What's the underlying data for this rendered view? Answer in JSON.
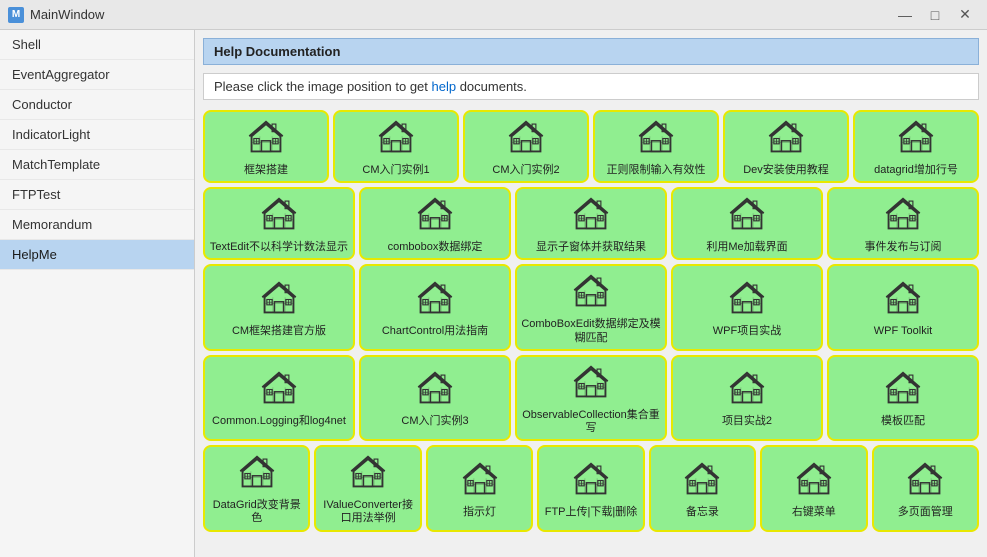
{
  "window": {
    "title": "MainWindow",
    "icon": "M",
    "minimize_label": "—",
    "maximize_label": "□",
    "close_label": "✕"
  },
  "sidebar": {
    "items": [
      {
        "id": "shell",
        "label": "Shell",
        "active": false
      },
      {
        "id": "event-aggregator",
        "label": "EventAggregator",
        "active": false
      },
      {
        "id": "conductor",
        "label": "Conductor",
        "active": false
      },
      {
        "id": "indicator-light",
        "label": "IndicatorLight",
        "active": false
      },
      {
        "id": "match-template",
        "label": "MatchTemplate",
        "active": false
      },
      {
        "id": "ftp-test",
        "label": "FTPTest",
        "active": false
      },
      {
        "id": "memorandum",
        "label": "Memorandum",
        "active": false
      },
      {
        "id": "help-me",
        "label": "HelpMe",
        "active": true
      }
    ]
  },
  "help": {
    "header": "Help Documentation",
    "description_plain": "Please click the image position to get ",
    "description_link": "help",
    "description_end": " documents."
  },
  "grid_rows": [
    [
      {
        "id": "tile-1",
        "label": "框架搭建"
      },
      {
        "id": "tile-2",
        "label": "CM入门实例1"
      },
      {
        "id": "tile-3",
        "label": "CM入门实例2"
      },
      {
        "id": "tile-4",
        "label": "正则限制输入有效性"
      },
      {
        "id": "tile-5",
        "label": "Dev安装使用教程"
      },
      {
        "id": "tile-6",
        "label": "datagrid增加行号"
      }
    ],
    [
      {
        "id": "tile-7",
        "label": "TextEdit不以科学计数法显示"
      },
      {
        "id": "tile-8",
        "label": "combobox数据绑定"
      },
      {
        "id": "tile-9",
        "label": "显示子窗体并获取结果"
      },
      {
        "id": "tile-10",
        "label": "利用Me加载界面"
      },
      {
        "id": "tile-11",
        "label": "事件发布与订阅"
      }
    ],
    [
      {
        "id": "tile-12",
        "label": "CM框架搭建官方版"
      },
      {
        "id": "tile-13",
        "label": "ChartControl用法指南"
      },
      {
        "id": "tile-14",
        "label": "ComboBoxEdit数据绑定及模糊匹配"
      },
      {
        "id": "tile-15",
        "label": "WPF项目实战"
      },
      {
        "id": "tile-16",
        "label": "WPF Toolkit"
      }
    ],
    [
      {
        "id": "tile-17",
        "label": "Common.Logging和log4net"
      },
      {
        "id": "tile-18",
        "label": "CM入门实例3"
      },
      {
        "id": "tile-19",
        "label": "ObservableCollection集合重写"
      },
      {
        "id": "tile-20",
        "label": "项目实战2"
      },
      {
        "id": "tile-21",
        "label": "模板匹配"
      }
    ],
    [
      {
        "id": "tile-22",
        "label": "DataGrid改变背景色"
      },
      {
        "id": "tile-23",
        "label": "IValueConverter接口用法举例"
      },
      {
        "id": "tile-24",
        "label": "指示灯"
      },
      {
        "id": "tile-25",
        "label": "FTP上传|下载|删除"
      },
      {
        "id": "tile-26",
        "label": "备忘录"
      },
      {
        "id": "tile-27",
        "label": "右键菜单"
      },
      {
        "id": "tile-28",
        "label": "多页面管理"
      }
    ]
  ]
}
